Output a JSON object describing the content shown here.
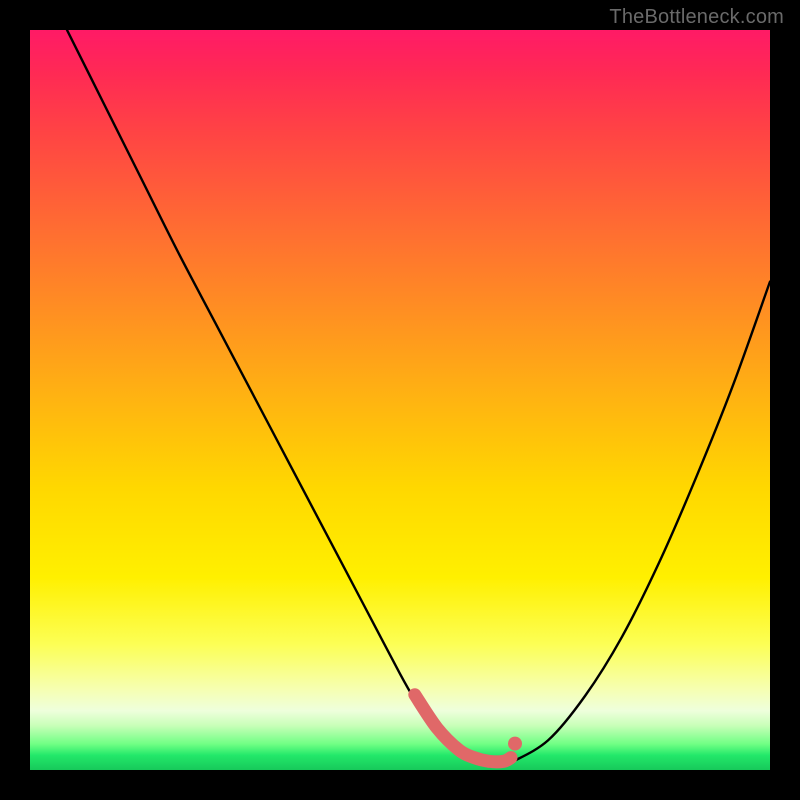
{
  "attribution": "TheBottleneck.com",
  "chart_data": {
    "type": "line",
    "title": "",
    "xlabel": "",
    "ylabel": "",
    "xlim": [
      0,
      100
    ],
    "ylim": [
      0,
      100
    ],
    "series": [
      {
        "name": "curve",
        "x": [
          5,
          10,
          15,
          20,
          25,
          30,
          35,
          40,
          45,
          50,
          52,
          55,
          58,
          60,
          62,
          64,
          65,
          70,
          75,
          80,
          85,
          90,
          95,
          100
        ],
        "y": [
          100,
          90,
          80,
          70,
          60.5,
          51,
          41.5,
          32,
          22.5,
          13,
          9.5,
          5,
          2,
          1,
          0.5,
          0.5,
          1,
          4,
          10,
          18,
          28,
          39.5,
          52,
          66
        ]
      }
    ],
    "flat_region": {
      "x_start": 52,
      "x_end": 65
    },
    "flat_marker_color": "#e06868",
    "gradient_stops": [
      {
        "pos": 0,
        "color": "#ff1a66"
      },
      {
        "pos": 0.5,
        "color": "#ffd800"
      },
      {
        "pos": 0.92,
        "color": "#eeffdc"
      },
      {
        "pos": 1.0,
        "color": "#17c95a"
      }
    ]
  }
}
